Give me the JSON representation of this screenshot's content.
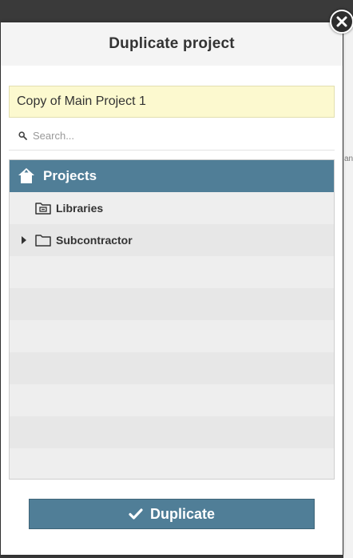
{
  "dialog": {
    "title": "Duplicate project",
    "name_value": "Copy of Main Project 1",
    "search_placeholder": "Search...",
    "tree": {
      "root_label": "Projects",
      "items": [
        {
          "label": "Libraries",
          "icon": "library-folder-icon",
          "expandable": false
        },
        {
          "label": "Subcontractor",
          "icon": "folder-icon",
          "expandable": true
        }
      ]
    },
    "duplicate_label": "Duplicate"
  },
  "background": {
    "fragment": "an"
  },
  "colors": {
    "accent": "#507e97",
    "input_bg": "#fcf9cf",
    "backdrop": "#3a3a3a"
  }
}
